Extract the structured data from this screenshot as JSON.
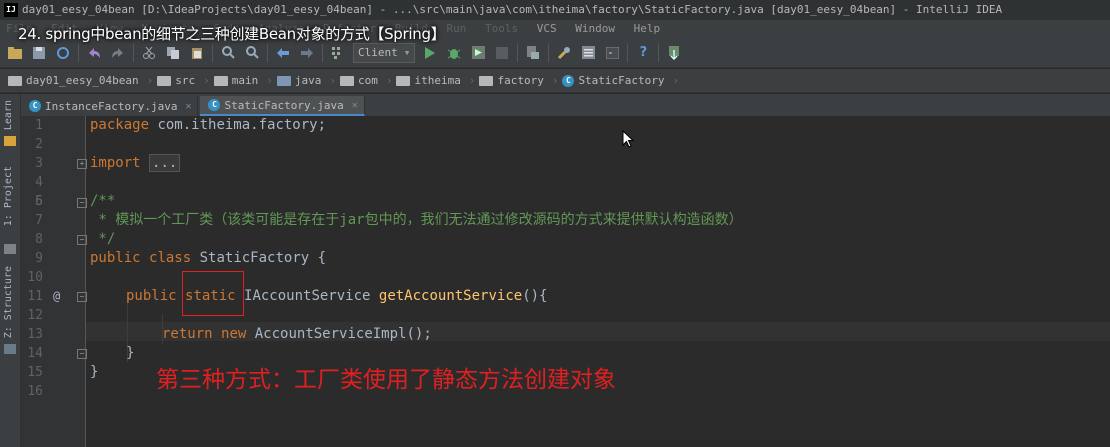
{
  "window": {
    "title": "day01_eesy_04bean [D:\\IdeaProjects\\day01_eesy_04bean] - ...\\src\\main\\java\\com\\itheima\\factory\\StaticFactory.java [day01_eesy_04bean] - IntelliJ IDEA",
    "logo": "IJ"
  },
  "overlay": {
    "video_title": "24. spring中bean的细节之三种创建Bean对象的方式【Spring】"
  },
  "menu": {
    "items": [
      "File",
      "Edit",
      "View",
      "Navigate",
      "Code",
      "Analyze",
      "Refactor",
      "Build",
      "Run",
      "Tools",
      "VCS",
      "Window",
      "Help"
    ]
  },
  "toolbar": {
    "run_config": "Client"
  },
  "breadcrumb": {
    "items": [
      "day01_eesy_04bean",
      "src",
      "main",
      "java",
      "com",
      "itheima",
      "factory",
      "StaticFactory"
    ]
  },
  "side_tabs": {
    "learn": "Learn",
    "project": "1: Project",
    "structure": "Z: Structure"
  },
  "editor_tabs": [
    {
      "label": "InstanceFactory.java"
    },
    {
      "label": "StaticFactory.java"
    }
  ],
  "code": {
    "line_numbers": [
      "1",
      "2",
      "3",
      "4",
      "5",
      "6",
      "7",
      "8",
      "9",
      "10",
      "11",
      "12",
      "13",
      "14",
      "15",
      "16"
    ],
    "l1_pkg": "package",
    "l1_name": " com.itheima.factory;",
    "l3_import": "import",
    "l3_dots": "...",
    "l6": "/**",
    "l7": " * 模拟一个工厂类（该类可能是存在于jar包中的，我们无法通过修改源码的方式来提供默认构造函数）",
    "l8": " */",
    "l9_public": "public",
    "l9_class": "class",
    "l9_rest": " StaticFactory {",
    "l11_public": "public",
    "l11_static": "static",
    "l11_type": " IAccountService ",
    "l11_fn": "getAccountService",
    "l11_rest": "(){",
    "l12_return": "return",
    "l12_new": "new",
    "l12_rest": " AccountServiceImpl();",
    "l13": "}",
    "l14": "}"
  },
  "annotation": {
    "text": "第三种方式：工厂类使用了静态方法创建对象",
    "color": "#e02020"
  }
}
